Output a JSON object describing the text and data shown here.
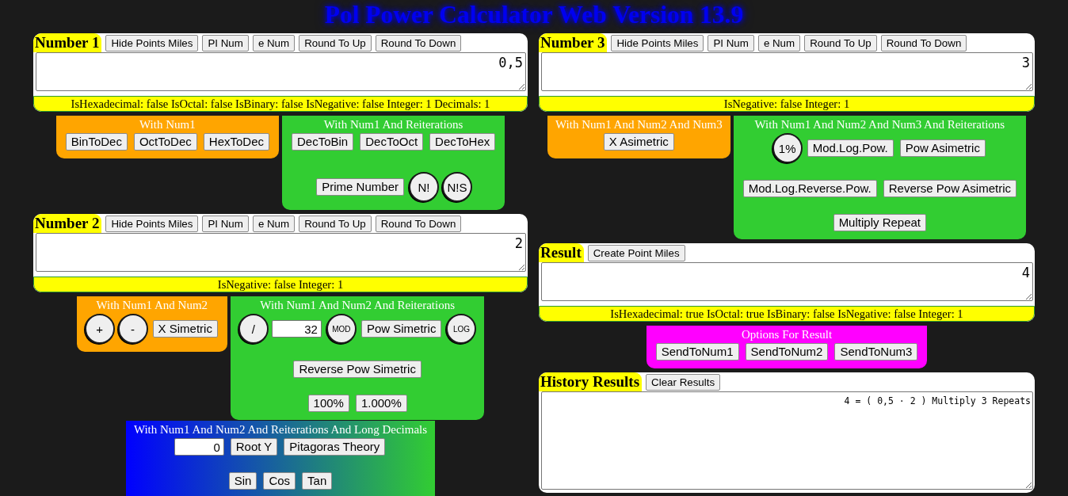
{
  "title": "Pol Power Calculator Web Version 13.9",
  "columns": [
    {
      "sections": [
        {
          "kind": "number",
          "title": "Number 1",
          "buttons": [
            "Hide Points Miles",
            "PI Num",
            "e Num",
            "Round To Up",
            "Round To Down"
          ],
          "value": "0,5",
          "info": "IsHexadecimal: false IsOctal: false IsBinary: false IsNegative: false Integer: 1 Decimals: 1"
        },
        {
          "kind": "groups",
          "groups": [
            {
              "kind": "basic",
              "title": "With Num1",
              "lines": [
                {
                  "controls": [
                    {
                      "kind": "button",
                      "label": "BinToDec"
                    },
                    {
                      "kind": "button",
                      "label": "OctToDec"
                    },
                    {
                      "kind": "button",
                      "label": "HexToDec"
                    }
                  ]
                }
              ]
            },
            {
              "kind": "reiterations",
              "title": "With Num1 And Reiterations",
              "lines": [
                {
                  "controls": [
                    {
                      "kind": "button",
                      "label": "DecToBin"
                    },
                    {
                      "kind": "button",
                      "label": "DecToOct"
                    },
                    {
                      "kind": "button",
                      "label": "DecToHex"
                    }
                  ]
                },
                {
                  "controls": [
                    {
                      "kind": "button",
                      "label": "Prime Number"
                    },
                    {
                      "kind": "circle",
                      "label": "N!"
                    },
                    {
                      "kind": "circle",
                      "label": "N!S"
                    }
                  ]
                }
              ]
            }
          ]
        },
        {
          "kind": "number",
          "title": "Number 2",
          "buttons": [
            "Hide Points Miles",
            "PI Num",
            "e Num",
            "Round To Up",
            "Round To Down"
          ],
          "value": "2",
          "info": "IsNegative: false Integer: 1"
        },
        {
          "kind": "groups",
          "groups": [
            {
              "kind": "basic",
              "title": "With Num1 And Num2",
              "lines": [
                {
                  "controls": [
                    {
                      "kind": "circle",
                      "label": "+"
                    },
                    {
                      "kind": "circle",
                      "label": "-"
                    },
                    {
                      "kind": "button",
                      "label": "X Simetric"
                    }
                  ]
                }
              ]
            },
            {
              "kind": "reiterations",
              "title": "With Num1 And Num2 And Reiterations",
              "lines": [
                {
                  "controls": [
                    {
                      "kind": "circle",
                      "label": "/"
                    },
                    {
                      "kind": "input",
                      "value": "32"
                    },
                    {
                      "kind": "smallcircle",
                      "label": "MOD"
                    },
                    {
                      "kind": "button",
                      "label": "Pow Simetric"
                    },
                    {
                      "kind": "smallcircle",
                      "label": "LOG"
                    }
                  ]
                },
                {
                  "controls": [
                    {
                      "kind": "button",
                      "label": "Reverse Pow Simetric"
                    }
                  ]
                },
                {
                  "controls": [
                    {
                      "kind": "button",
                      "label": "100%"
                    },
                    {
                      "kind": "button",
                      "label": "1.000%"
                    }
                  ]
                }
              ]
            }
          ]
        },
        {
          "kind": "groups",
          "groups": [
            {
              "kind": "long_decimals",
              "title": "With Num1 And Num2 And Reiterations And Long Decimals",
              "lines": [
                {
                  "controls": [
                    {
                      "kind": "input",
                      "value": "0"
                    },
                    {
                      "kind": "button",
                      "label": "Root Y"
                    },
                    {
                      "kind": "button",
                      "label": "Pitagoras Theory"
                    }
                  ]
                },
                {
                  "controls": [
                    {
                      "kind": "button",
                      "label": "Sin"
                    },
                    {
                      "kind": "button",
                      "label": "Cos"
                    },
                    {
                      "kind": "button",
                      "label": "Tan"
                    }
                  ]
                }
              ]
            }
          ]
        }
      ]
    },
    {
      "sections": [
        {
          "kind": "number",
          "title": "Number 3",
          "buttons": [
            "Hide Points Miles",
            "PI Num",
            "e Num",
            "Round To Up",
            "Round To Down"
          ],
          "value": "3",
          "info": "IsNegative: false Integer: 1"
        },
        {
          "kind": "groups",
          "groups": [
            {
              "kind": "basic",
              "title": "With Num1 And Num2 And Num3",
              "lines": [
                {
                  "controls": [
                    {
                      "kind": "button",
                      "label": "X Asimetric"
                    }
                  ]
                }
              ]
            },
            {
              "kind": "reiterations",
              "title": "With Num1 And Num2 And Num3 And Reiterations",
              "lines": [
                {
                  "controls": [
                    {
                      "kind": "circle",
                      "label": "1%"
                    },
                    {
                      "kind": "button",
                      "label": "Mod.Log.Pow."
                    },
                    {
                      "kind": "button",
                      "label": "Pow Asimetric"
                    }
                  ]
                },
                {
                  "controls": [
                    {
                      "kind": "button",
                      "label": "Mod.Log.Reverse.Pow."
                    },
                    {
                      "kind": "button",
                      "label": "Reverse Pow Asimetric"
                    }
                  ]
                },
                {
                  "controls": [
                    {
                      "kind": "button",
                      "label": "Multiply Repeat"
                    }
                  ]
                }
              ]
            }
          ]
        },
        {
          "kind": "number",
          "title": "Result",
          "buttons": [
            "Create Point Miles"
          ],
          "value": "4",
          "info": "IsHexadecimal: true IsOctal: true IsBinary: false IsNegative: false Integer: 1"
        },
        {
          "kind": "groups",
          "groups": [
            {
              "kind": "options",
              "title": "Options For Result",
              "lines": [
                {
                  "controls": [
                    {
                      "kind": "button",
                      "label": "SendToNum1"
                    },
                    {
                      "kind": "button",
                      "label": "SendToNum2"
                    },
                    {
                      "kind": "button",
                      "label": "SendToNum3"
                    }
                  ]
                }
              ]
            }
          ]
        },
        {
          "kind": "history",
          "title": "History Results",
          "buttons": [
            "Clear Results"
          ],
          "value": "4 = ( 0,5 · 2 ) Multiply 3 Repeats"
        }
      ]
    }
  ]
}
